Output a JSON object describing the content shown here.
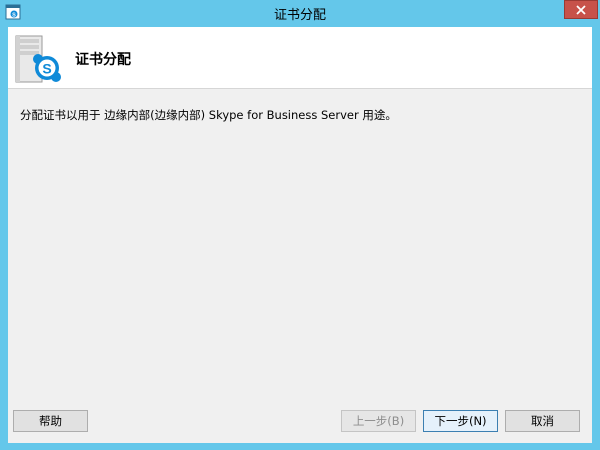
{
  "window": {
    "title": "证书分配",
    "icon": "app-window-icon",
    "close_icon": "close-icon"
  },
  "header": {
    "title": "证书分配",
    "icon": "skype-server-icon"
  },
  "content": {
    "description": "分配证书以用于 边缘内部(边缘内部) Skype for Business Server 用途。"
  },
  "buttons": {
    "help": "帮助",
    "previous": "上一步(B)",
    "next": "下一步(N)",
    "cancel": "取消"
  },
  "colors": {
    "titlebar": "#64c7ea",
    "close_button": "#c7524a",
    "client_background": "#f0f0f0",
    "skype_blue": "#0f8ad8"
  }
}
